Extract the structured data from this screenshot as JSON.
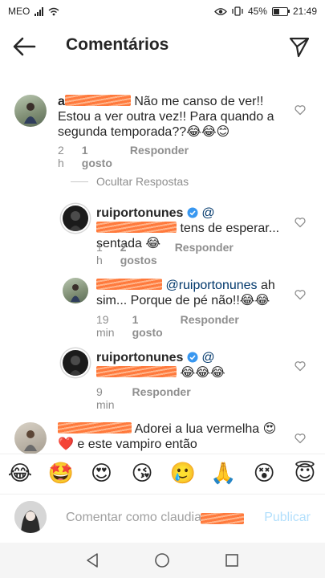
{
  "status": {
    "carrier": "MEO",
    "battery": "45%",
    "time": "21:49",
    "battery_level": 0.45
  },
  "header": {
    "title": "Comentários"
  },
  "comments": [
    {
      "username_visible": "a",
      "text": "Não me canso de ver!! Estou a ver outra vez!! Para quando a segunda temporada??😂😂😊",
      "time": "2 h",
      "likes": "1 gosto",
      "reply": "Responder"
    },
    {
      "username_visible": "",
      "text": "Adorei a lua vermelha 😍 ❤️ e este vampiro então"
    }
  ],
  "hide_replies": "Ocultar Respostas",
  "replies": [
    {
      "username": "ruiportonunes",
      "mention": "@",
      "text": "tens de esperar... sentada 😂",
      "time": "1 h",
      "likes": "2 gostos",
      "reply": "Responder"
    },
    {
      "username_visible": "",
      "mention": "@ruiportonunes",
      "text": "ah sim... Porque de pé não!!😂😂",
      "time": "19 min",
      "likes": "1 gosto",
      "reply": "Responder"
    },
    {
      "username": "ruiportonunes",
      "mention": "@",
      "text": "😂😂😂",
      "time": "9 min",
      "reply": "Responder"
    }
  ],
  "emoji_bar": [
    "😂",
    "🤩",
    "😍",
    "😘",
    "🥲",
    "🙏",
    "😵",
    "😇"
  ],
  "composer": {
    "placeholder": "Comentar como claudia",
    "publish": "Publicar"
  },
  "icons": {
    "back": "arrow-left-icon",
    "send": "paper-plane-icon",
    "heart": "heart-outline-icon",
    "verified": "verified-badge-icon"
  }
}
